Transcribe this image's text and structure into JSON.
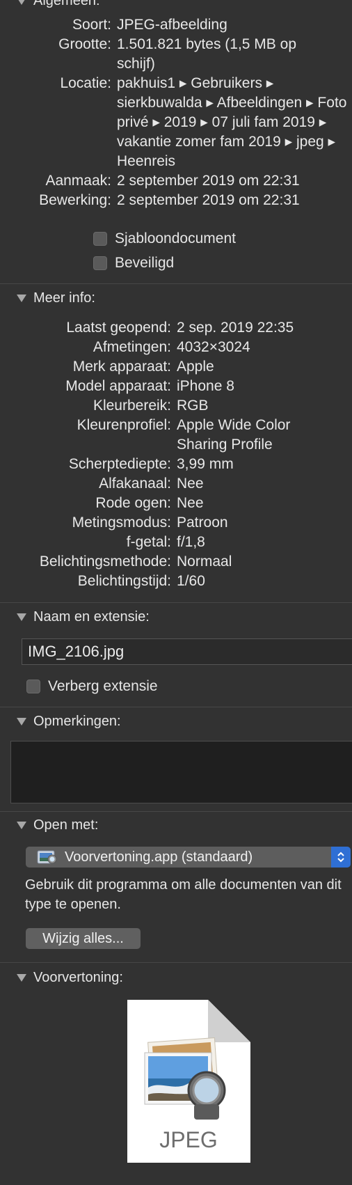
{
  "general": {
    "header_label": "Algemeen:",
    "rows": [
      {
        "key": "Soort:",
        "value": "JPEG-afbeelding"
      },
      {
        "key": "Grootte:",
        "value": "1.501.821 bytes (1,5 MB op schijf)"
      },
      {
        "key": "Locatie:",
        "value": "pakhuis1 ▸ Gebruikers ▸ sierkbuwalda ▸ Afbeeldingen ▸ Foto privé ▸ 2019 ▸ 07 juli fam 2019 ▸ vakantie zomer fam 2019 ▸ jpeg ▸ Heenreis"
      },
      {
        "key": "Aanmaak:",
        "value": "2 september 2019 om 22:31"
      },
      {
        "key": "Bewerking:",
        "value": "2 september 2019 om 22:31"
      }
    ],
    "stationery_label": "Sjabloondocument",
    "locked_label": "Beveiligd"
  },
  "more_info": {
    "header_label": "Meer info:",
    "rows": [
      {
        "key": "Laatst geopend:",
        "value": "2 sep. 2019 22:35"
      },
      {
        "key": "Afmetingen:",
        "value": "4032×3024"
      },
      {
        "key": "Merk apparaat:",
        "value": "Apple"
      },
      {
        "key": "Model apparaat:",
        "value": "iPhone 8"
      },
      {
        "key": "Kleurbereik:",
        "value": "RGB"
      },
      {
        "key": "Kleurenprofiel:",
        "value": "Apple Wide Color Sharing Profile"
      },
      {
        "key": "Scherptediepte:",
        "value": "3,99 mm"
      },
      {
        "key": "Alfakanaal:",
        "value": "Nee"
      },
      {
        "key": "Rode ogen:",
        "value": "Nee"
      },
      {
        "key": "Metingsmodus:",
        "value": "Patroon"
      },
      {
        "key": "f-getal:",
        "value": "f/1,8"
      },
      {
        "key": "Belichtingsmethode:",
        "value": "Normaal"
      },
      {
        "key": "Belichtingstijd:",
        "value": "1/60"
      }
    ]
  },
  "name_ext": {
    "header_label": "Naam en extensie:",
    "filename": "IMG_2106.jpg",
    "hide_ext_label": "Verberg extensie"
  },
  "comments": {
    "header_label": "Opmerkingen:"
  },
  "open_with": {
    "header_label": "Open met:",
    "app_icon": "preview-app-icon",
    "selected_app": "Voorvertoning.app (standaard)",
    "help_text": "Gebruik dit programma om alle documenten van dit type te openen.",
    "change_all_label": "Wijzig alles..."
  },
  "preview": {
    "header_label": "Voorvertoning:",
    "file_type_label": "JPEG"
  },
  "colors": {
    "background": "#323232",
    "accent_blue": "#2f6fd4",
    "text": "#e8e8e8"
  }
}
